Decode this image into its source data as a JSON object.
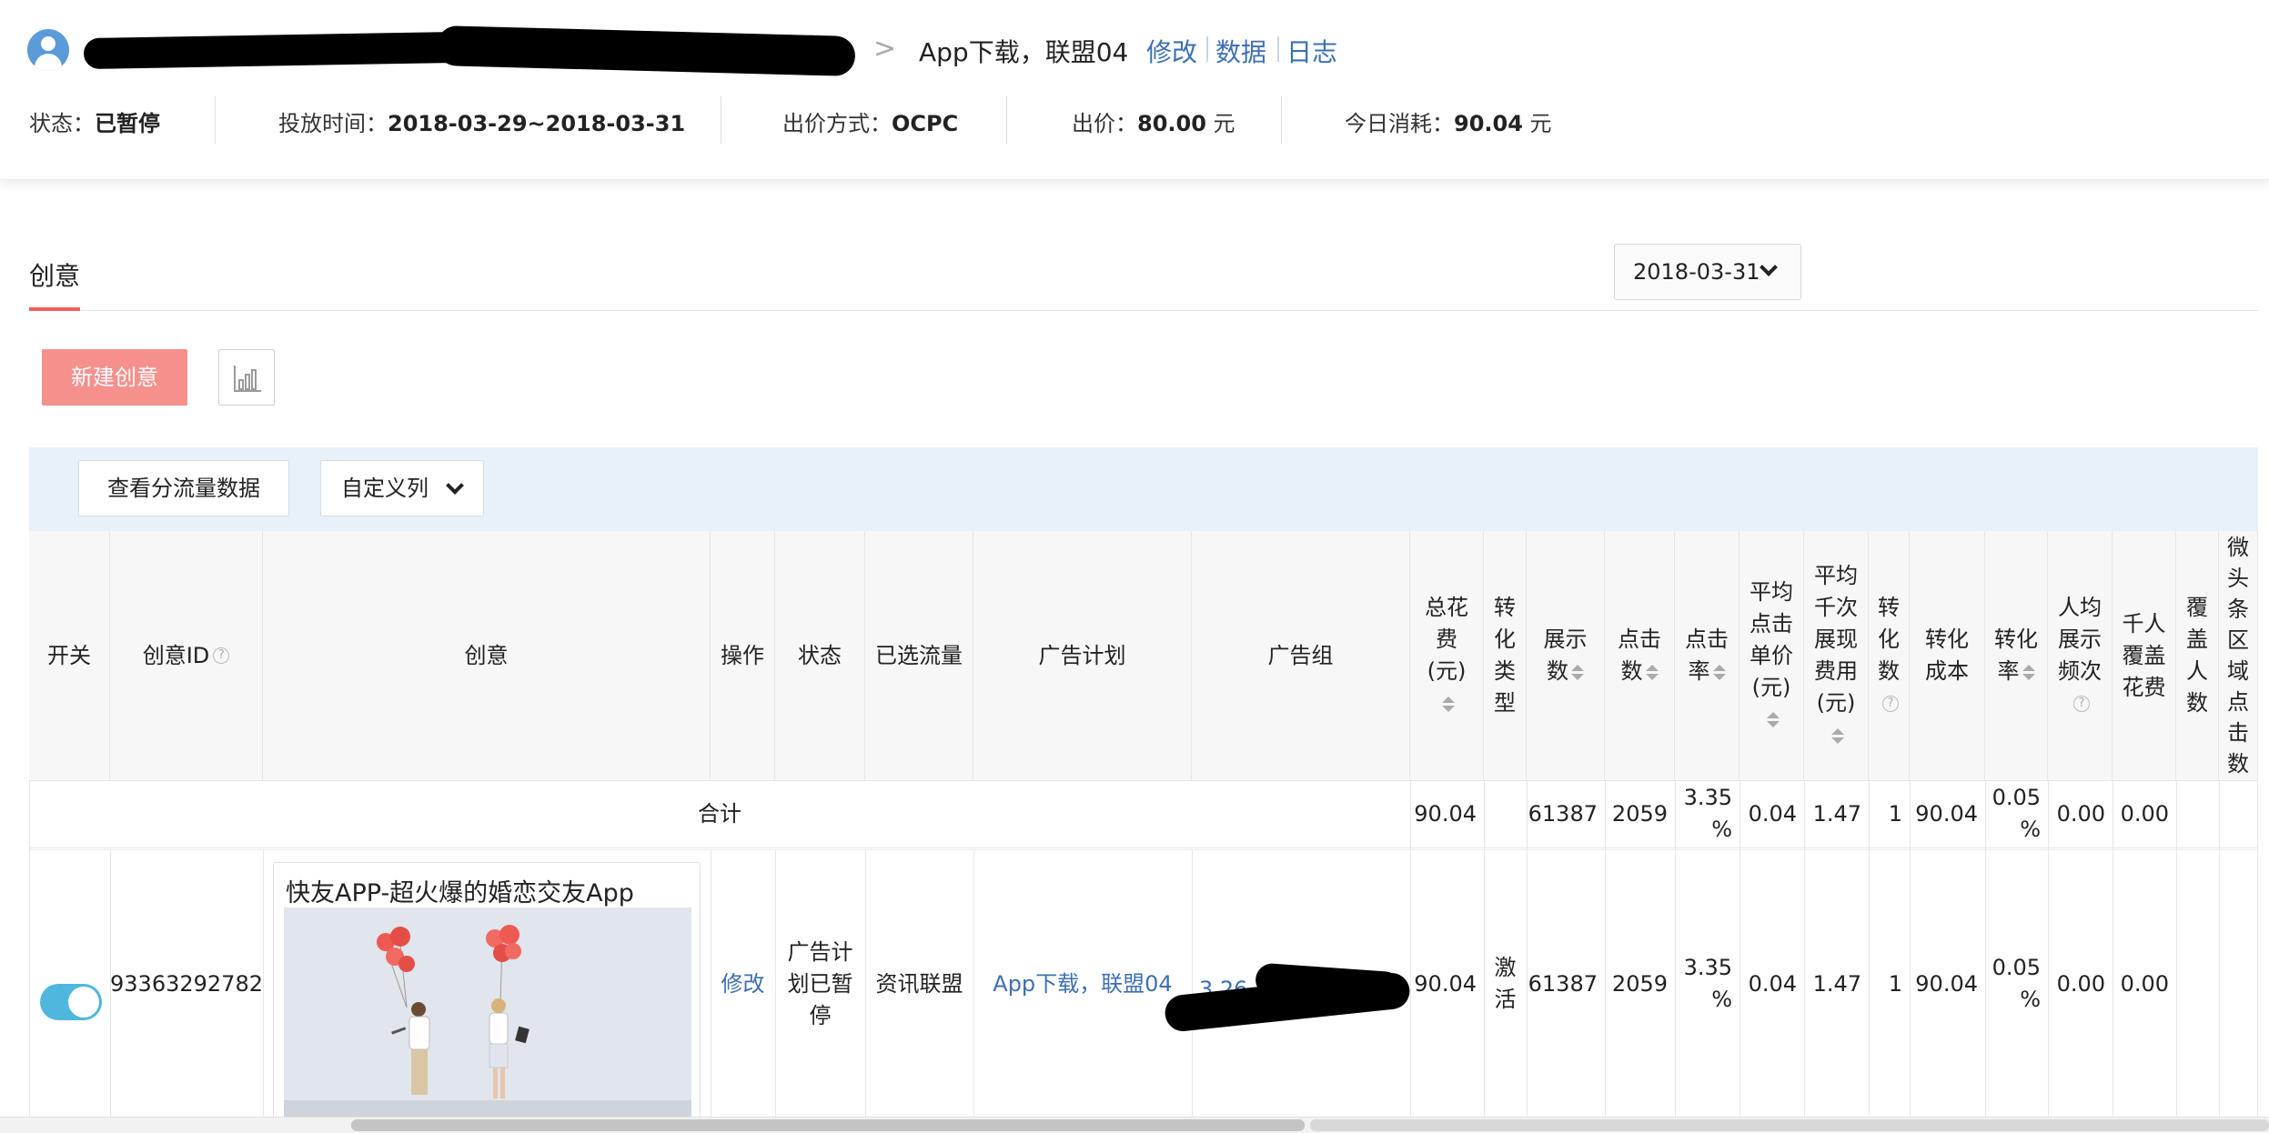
{
  "header": {
    "breadcrumb_sep": ">",
    "plan_name": "App下载，联盟04",
    "links": [
      "修改",
      "数据",
      "日志"
    ],
    "status_label": "状态：",
    "status_value": "已暂停",
    "time_label": "投放时间：",
    "time_value": "2018-03-29~2018-03-31",
    "bid_mode_label": "出价方式：",
    "bid_mode_value": "OCPC",
    "bid_label": "出价：",
    "bid_value": "80.00",
    "bid_unit": " 元",
    "cost_label": "今日消耗：",
    "cost_value": "90.04",
    "cost_unit": " 元"
  },
  "section": {
    "tab": "创意",
    "date": "2018-03-31",
    "new_button": "新建创意",
    "chart_icon": "bar-chart-icon"
  },
  "toolbar": {
    "flow_button": "查看分流量数据",
    "custom_columns": "自定义列"
  },
  "table": {
    "headers": {
      "switch": "开关",
      "id": "创意ID",
      "creative": "创意",
      "op": "操作",
      "status": "状态",
      "flow": "已选流量",
      "plan": "广告计划",
      "group": "广告组",
      "cost_l1": "总花",
      "cost_l2": "费",
      "cost_l3": "(元)",
      "ctype_l1": "转",
      "ctype_l2": "化类",
      "ctype_l3": "型",
      "show_l1": "展示",
      "show_l2": "数",
      "click_l1": "点击",
      "click_l2": "数",
      "ctr_l1": "点击",
      "ctr_l2": "率",
      "cpc_l1": "平均",
      "cpc_l2": "点击",
      "cpc_l3": "单价",
      "cpc_l4": "(元)",
      "cpm_l1": "平均",
      "cpm_l2": "千次",
      "cpm_l3": "展现",
      "cpm_l4": "费用",
      "cpm_l5": "(元)",
      "conv_l1": "转",
      "conv_l2": "化",
      "conv_l3": "数",
      "cvcost_l1": "转化",
      "cvcost_l2": "成本",
      "cvr_l1": "转化",
      "cvr_l2": "率",
      "freq_l1": "人均",
      "freq_l2": "展示",
      "freq_l3": "频次",
      "kcost_l1": "千人",
      "kcost_l2": "覆盖",
      "kcost_l3": "花费",
      "reach_l1": "覆",
      "reach_l2": "盖人",
      "reach_l3": "数",
      "wtt_l1": "微",
      "wtt_l2": "头",
      "wtt_l3": "条",
      "wtt_l4": "区",
      "wtt_l5": "域",
      "wtt_l6": "点",
      "wtt_l7": "击",
      "wtt_l8": "数"
    },
    "total": {
      "label": "合计",
      "cost": "90.04",
      "show": "61387",
      "click": "2059",
      "ctr_l1": "3.35",
      "ctr_l2": "%",
      "cpc": "0.04",
      "cpm": "1.47",
      "conv": "1",
      "cvcost": "90.04",
      "cvr_l1": "0.05",
      "cvr_l2": "%",
      "freq": "0.00",
      "kcost": "0.00"
    },
    "row": {
      "switch_on": true,
      "id": "93363292782",
      "creative_title": "快友APP-超火爆的婚恋交友App",
      "op": "修改",
      "status_l1": "广告计",
      "status_l2": "划已暂",
      "status_l3": "停",
      "flow": "资讯联盟",
      "plan": "App下载，联盟04",
      "group_partial": "3.26",
      "cost": "90.04",
      "ctype_l1": "激",
      "ctype_l2": "活",
      "show": "61387",
      "click": "2059",
      "ctr_l1": "3.35",
      "ctr_l2": "%",
      "cpc": "0.04",
      "cpm": "1.47",
      "conv": "1",
      "cvcost": "90.04",
      "cvr_l1": "0.05",
      "cvr_l2": "%",
      "freq": "0.00",
      "kcost": "0.00"
    }
  },
  "colors": {
    "link": "#3d6fb4",
    "primary_button": "#f6908d",
    "tab_indicator": "#f0605d",
    "toolbar_bg": "#e6f1f9",
    "toggle_on": "#4fb7dd"
  }
}
